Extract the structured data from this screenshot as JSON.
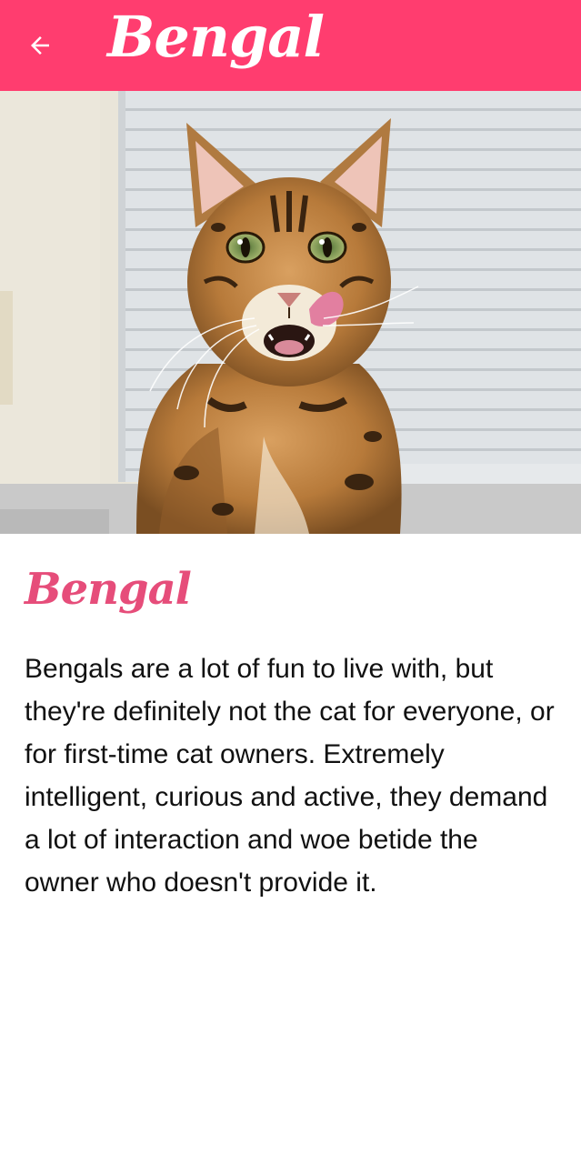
{
  "app_bar": {
    "title": "Bengal",
    "back_icon": "arrow-left-icon",
    "background_color": "#ff3d6f"
  },
  "hero": {
    "image": "bengal-cat-photo"
  },
  "content": {
    "heading": "Bengal",
    "heading_color": "#e64d7a",
    "description": "Bengals are a lot of fun to live with, but they're definitely not the cat for everyone, or for first-time cat owners. Extremely intelligent, curious and active, they demand a lot of interaction and woe betide the owner who doesn't provide it."
  }
}
